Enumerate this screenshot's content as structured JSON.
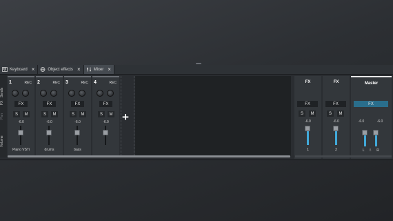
{
  "tabs": [
    {
      "label": "Keyboard",
      "icon": "keyboard-icon"
    },
    {
      "label": "Object effects",
      "icon": "globe-icon"
    },
    {
      "label": "Mixer",
      "icon": "mixer-icon",
      "active": true
    }
  ],
  "row_labels": {
    "sends": "Sends",
    "fx": "FX",
    "pan": "Pan",
    "volume": "Volume"
  },
  "channels": [
    {
      "number": "1",
      "rec": "REC",
      "fx": "FX",
      "solo": "S",
      "mute": "M",
      "level": "-6.0",
      "name": "Piano VSTi"
    },
    {
      "number": "2",
      "rec": "REC",
      "fx": "FX",
      "solo": "S",
      "mute": "M",
      "level": "-6.0",
      "name": "drums"
    },
    {
      "number": "3",
      "rec": "REC",
      "fx": "FX",
      "solo": "S",
      "mute": "M",
      "level": "-6.0",
      "name": "bass"
    },
    {
      "number": "4",
      "rec": "REC",
      "fx": "FX",
      "solo": "S",
      "mute": "M",
      "level": "-6.0",
      "name": ""
    }
  ],
  "add_track": "+",
  "fx_returns": [
    {
      "title": "FX",
      "fx": "FX",
      "solo": "S",
      "mute": "M",
      "level": "-6.0",
      "name": "1"
    },
    {
      "title": "FX",
      "fx": "FX",
      "solo": "S",
      "mute": "M",
      "level": "-6.0",
      "name": "2"
    }
  ],
  "master": {
    "title": "Master",
    "fx": "FX",
    "level_l": "-6.0",
    "level_r": "-6.0",
    "left": "L",
    "link": "8",
    "right": "R"
  },
  "colors": {
    "accent": "#41a9d9",
    "master_fx": "#2a6e8c"
  }
}
